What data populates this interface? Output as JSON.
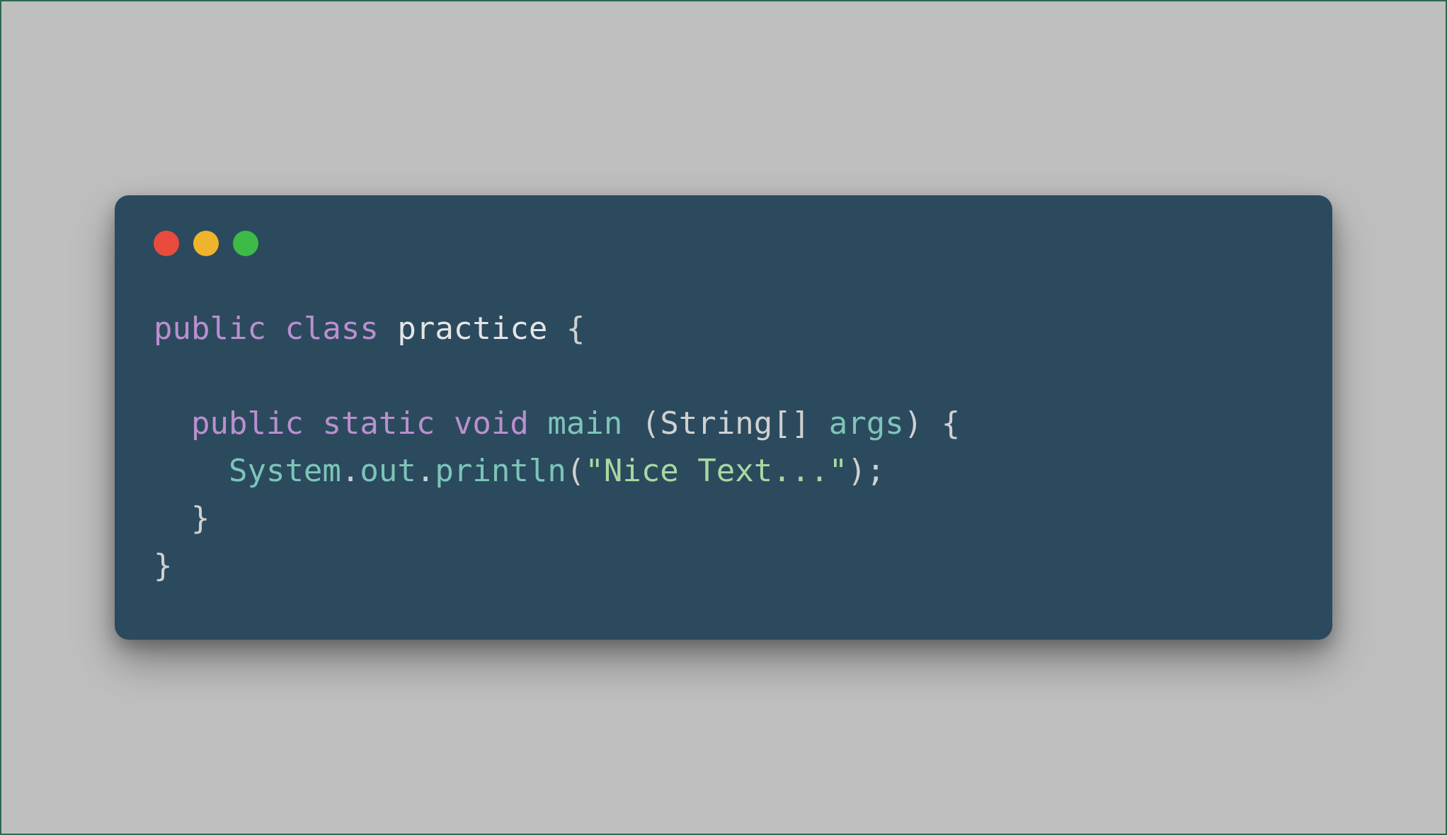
{
  "window": {
    "controls": {
      "close": "close",
      "minimize": "minimize",
      "maximize": "maximize"
    }
  },
  "code": {
    "line1": {
      "kw_public": "public",
      "kw_class": "class",
      "classname": "practice",
      "brace_open": "{"
    },
    "line2": {
      "kw_public": "public",
      "kw_static": "static",
      "kw_void": "void",
      "method": "main",
      "paren_open": "(",
      "type": "String[]",
      "param": "args",
      "paren_close": ")",
      "brace_open": "{"
    },
    "line3": {
      "obj_system": "System",
      "dot1": ".",
      "obj_out": "out",
      "dot2": ".",
      "method": "println",
      "paren_open": "(",
      "string": "\"Nice Text...\"",
      "paren_close": ")",
      "semicolon": ";"
    },
    "line4": {
      "brace_close": "}"
    },
    "line5": {
      "brace_close": "}"
    }
  }
}
